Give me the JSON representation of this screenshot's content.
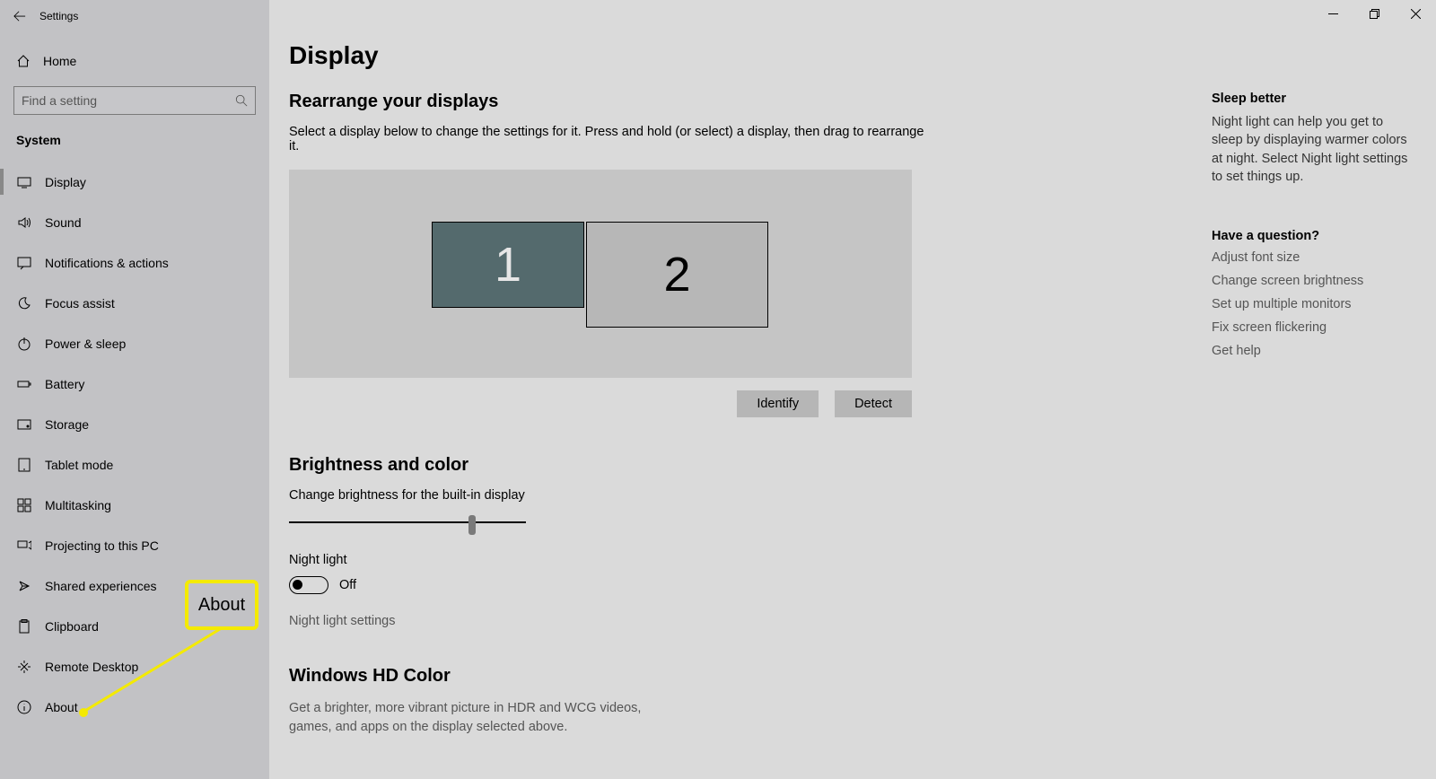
{
  "app_title": "Settings",
  "search_placeholder": "Find a setting",
  "home_label": "Home",
  "section_label": "System",
  "nav": [
    {
      "label": "Display",
      "selected": true
    },
    {
      "label": "Sound"
    },
    {
      "label": "Notifications & actions"
    },
    {
      "label": "Focus assist"
    },
    {
      "label": "Power & sleep"
    },
    {
      "label": "Battery"
    },
    {
      "label": "Storage"
    },
    {
      "label": "Tablet mode"
    },
    {
      "label": "Multitasking"
    },
    {
      "label": "Projecting to this PC"
    },
    {
      "label": "Shared experiences"
    },
    {
      "label": "Clipboard"
    },
    {
      "label": "Remote Desktop"
    },
    {
      "label": "About"
    }
  ],
  "page": {
    "title": "Display",
    "rearrange_heading": "Rearrange your displays",
    "rearrange_body": "Select a display below to change the settings for it. Press and hold (or select) a display, then drag to rearrange it.",
    "monitor1": "1",
    "monitor2": "2",
    "identify_button": "Identify",
    "detect_button": "Detect",
    "brightness_heading": "Brightness and color",
    "brightness_label": "Change brightness for the built-in display",
    "brightness_value_percent": 78,
    "nightlight_label": "Night light",
    "nightlight_state": "Off",
    "nightlight_settings_link": "Night light settings",
    "hd_heading": "Windows HD Color",
    "hd_body": "Get a brighter, more vibrant picture in HDR and WCG videos, games, and apps on the display selected above."
  },
  "right": {
    "sleep_heading": "Sleep better",
    "sleep_body": "Night light can help you get to sleep by displaying warmer colors at night. Select Night light settings to set things up.",
    "question_heading": "Have a question?",
    "links": [
      "Adjust font size",
      "Change screen brightness",
      "Set up multiple monitors",
      "Fix screen flickering",
      "Get help"
    ]
  },
  "annotation": {
    "callout_label": "About"
  }
}
